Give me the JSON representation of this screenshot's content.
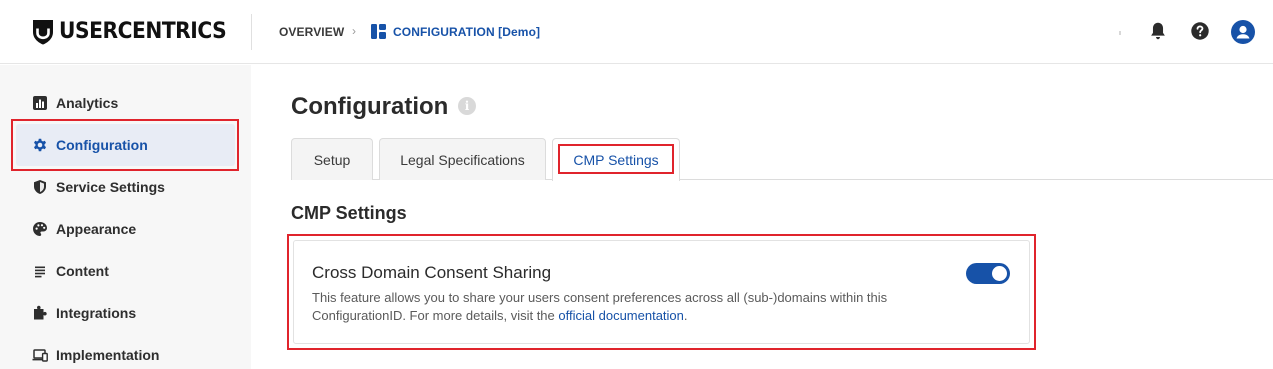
{
  "header": {
    "logo_text": "USERCENTRICS",
    "breadcrumb": {
      "overview": "OVERVIEW",
      "separator": "›",
      "configuration": "CONFIGURATION [Demo]"
    },
    "icons": [
      "bell-icon",
      "help-icon",
      "user-avatar-icon"
    ]
  },
  "sidebar": {
    "items": [
      {
        "label": "Analytics",
        "icon": "bar-chart-icon",
        "active": false
      },
      {
        "label": "Configuration",
        "icon": "gear-icon",
        "active": true
      },
      {
        "label": "Service Settings",
        "icon": "shield-icon",
        "active": false
      },
      {
        "label": "Appearance",
        "icon": "palette-icon",
        "active": false
      },
      {
        "label": "Content",
        "icon": "text-lines-icon",
        "active": false
      },
      {
        "label": "Integrations",
        "icon": "puzzle-icon",
        "active": false
      },
      {
        "label": "Implementation",
        "icon": "devices-icon",
        "active": false
      }
    ]
  },
  "main": {
    "title": "Configuration",
    "info_icon": "i",
    "tabs": [
      {
        "label": "Setup",
        "active": false
      },
      {
        "label": "Legal Specifications",
        "active": false
      },
      {
        "label": "CMP Settings",
        "active": true
      }
    ],
    "section_title": "CMP Settings",
    "card": {
      "title": "Cross Domain Consent Sharing",
      "description_before": "This feature allows you to share your users consent preferences across all (sub-)domains within this ConfigurationID. For more details, visit the ",
      "link_text": "official documentation",
      "description_after": ".",
      "toggle_on": true
    }
  },
  "colors": {
    "accent": "#1752a8",
    "highlight": "#e0242c",
    "sidebar_bg": "#f7f7f7",
    "active_nav_bg": "#e8ecf5"
  }
}
